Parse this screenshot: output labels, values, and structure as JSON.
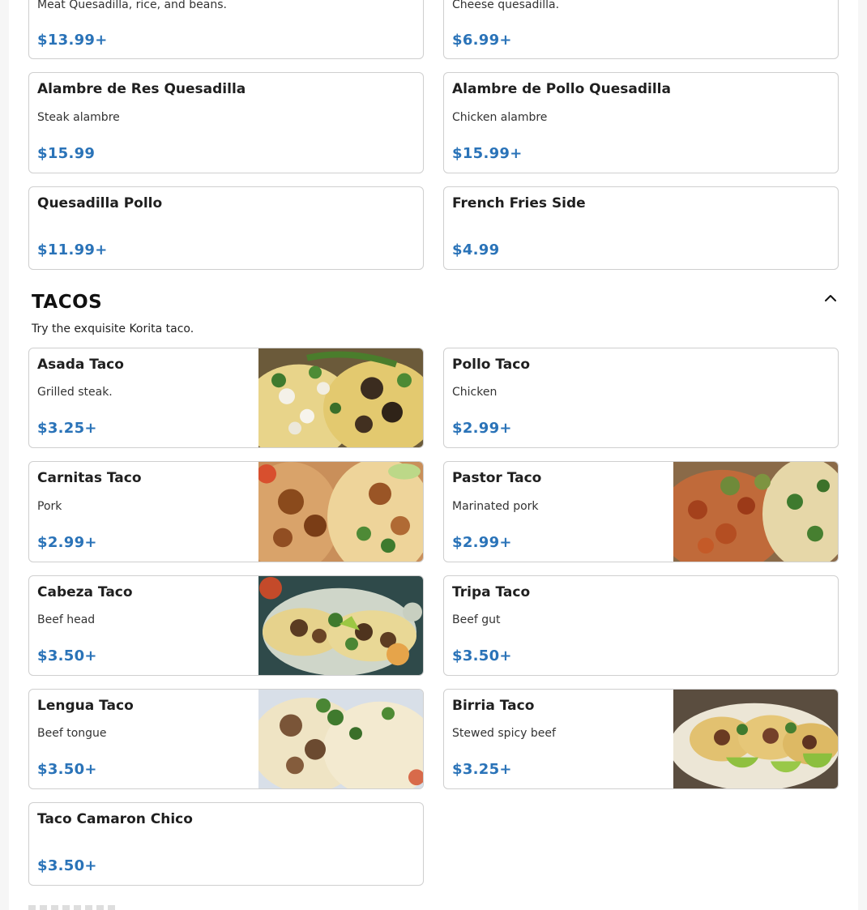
{
  "top_items": [
    {
      "name": "",
      "desc": "Meat Quesadilla, rice, and beans.",
      "price": "$13.99+"
    },
    {
      "name": "",
      "desc": "Cheese quesadilla.",
      "price": "$6.99+"
    },
    {
      "name": "Alambre de Res Quesadilla",
      "desc": "Steak alambre",
      "price": "$15.99"
    },
    {
      "name": "Alambre de Pollo Quesadilla",
      "desc": "Chicken alambre",
      "price": "$15.99+"
    },
    {
      "name": "Quesadilla Pollo",
      "desc": "",
      "price": "$11.99+"
    },
    {
      "name": "French Fries Side",
      "desc": "",
      "price": "$4.99"
    }
  ],
  "tacos_section": {
    "title": "TACOS",
    "subtitle": "Try the exquisite Korita taco.",
    "collapse_icon": "chevron-up-icon",
    "items": [
      {
        "name": "Asada Taco",
        "desc": "Grilled steak.",
        "price": "$3.25+",
        "image": "asada-taco-photo"
      },
      {
        "name": "Pollo Taco",
        "desc": "Chicken",
        "price": "$2.99+"
      },
      {
        "name": "Carnitas Taco",
        "desc": "Pork",
        "price": "$2.99+",
        "image": "carnitas-taco-photo"
      },
      {
        "name": "Pastor Taco",
        "desc": "Marinated pork",
        "price": "$2.99+",
        "image": "pastor-taco-photo"
      },
      {
        "name": "Cabeza Taco",
        "desc": "Beef head",
        "price": "$3.50+",
        "image": "cabeza-taco-photo"
      },
      {
        "name": "Tripa Taco",
        "desc": "Beef gut",
        "price": "$3.50+"
      },
      {
        "name": "Lengua Taco",
        "desc": "Beef tongue",
        "price": "$3.50+",
        "image": "lengua-taco-photo"
      },
      {
        "name": "Birria Taco",
        "desc": "Stewed spicy beef",
        "price": "$3.25+",
        "image": "birria-taco-photo"
      },
      {
        "name": "Taco Camaron Chico",
        "desc": "",
        "price": "$3.50+"
      }
    ]
  },
  "colors": {
    "price": "#2a73b8",
    "card_border": "#cfcfcf",
    "background": "#f6f6f6"
  }
}
